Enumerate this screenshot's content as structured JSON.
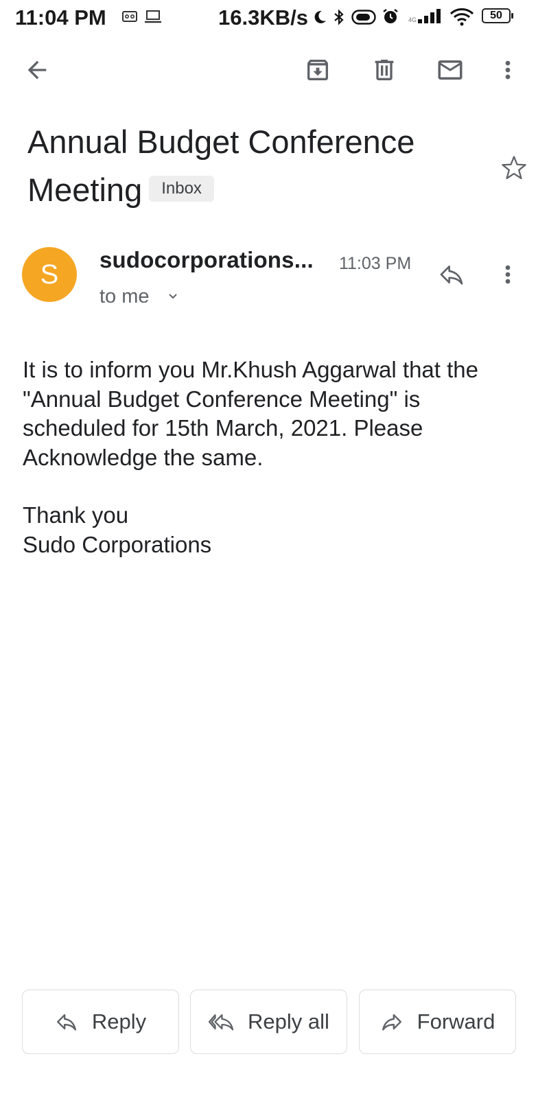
{
  "status_bar": {
    "time": "11:04 PM",
    "speed": "16.3KB/s",
    "battery": "50",
    "icons": [
      "voicemail-icon",
      "laptop-icon",
      "moon-icon",
      "bluetooth-icon",
      "toggle-icon",
      "alarm-icon",
      "signal-icon",
      "wifi-icon",
      "battery-icon"
    ]
  },
  "toolbar": {
    "icons": [
      "back-arrow-icon",
      "archive-icon",
      "delete-icon",
      "mark-unread-icon",
      "more-vert-icon"
    ]
  },
  "email": {
    "subject": "Annual Budget Conference Meeting",
    "label": "Inbox",
    "starred": false,
    "sender": {
      "avatar_letter": "S",
      "avatar_color": "#f5a623",
      "name": "sudocorporations...",
      "time": "11:03 PM",
      "recipient": "to me"
    },
    "body": {
      "paragraph1": "It is to inform you Mr.Khush Aggarwal that the \"Annual Budget Conference Meeting\" is scheduled for 15th March, 2021. Please Acknowledge the same.",
      "closing": "Thank you",
      "signature": "Sudo Corporations"
    }
  },
  "actions": {
    "reply": "Reply",
    "reply_all": "Reply all",
    "forward": "Forward"
  },
  "colors": {
    "icon": "#5f6368",
    "text": "#202124",
    "border": "#dadce0"
  }
}
